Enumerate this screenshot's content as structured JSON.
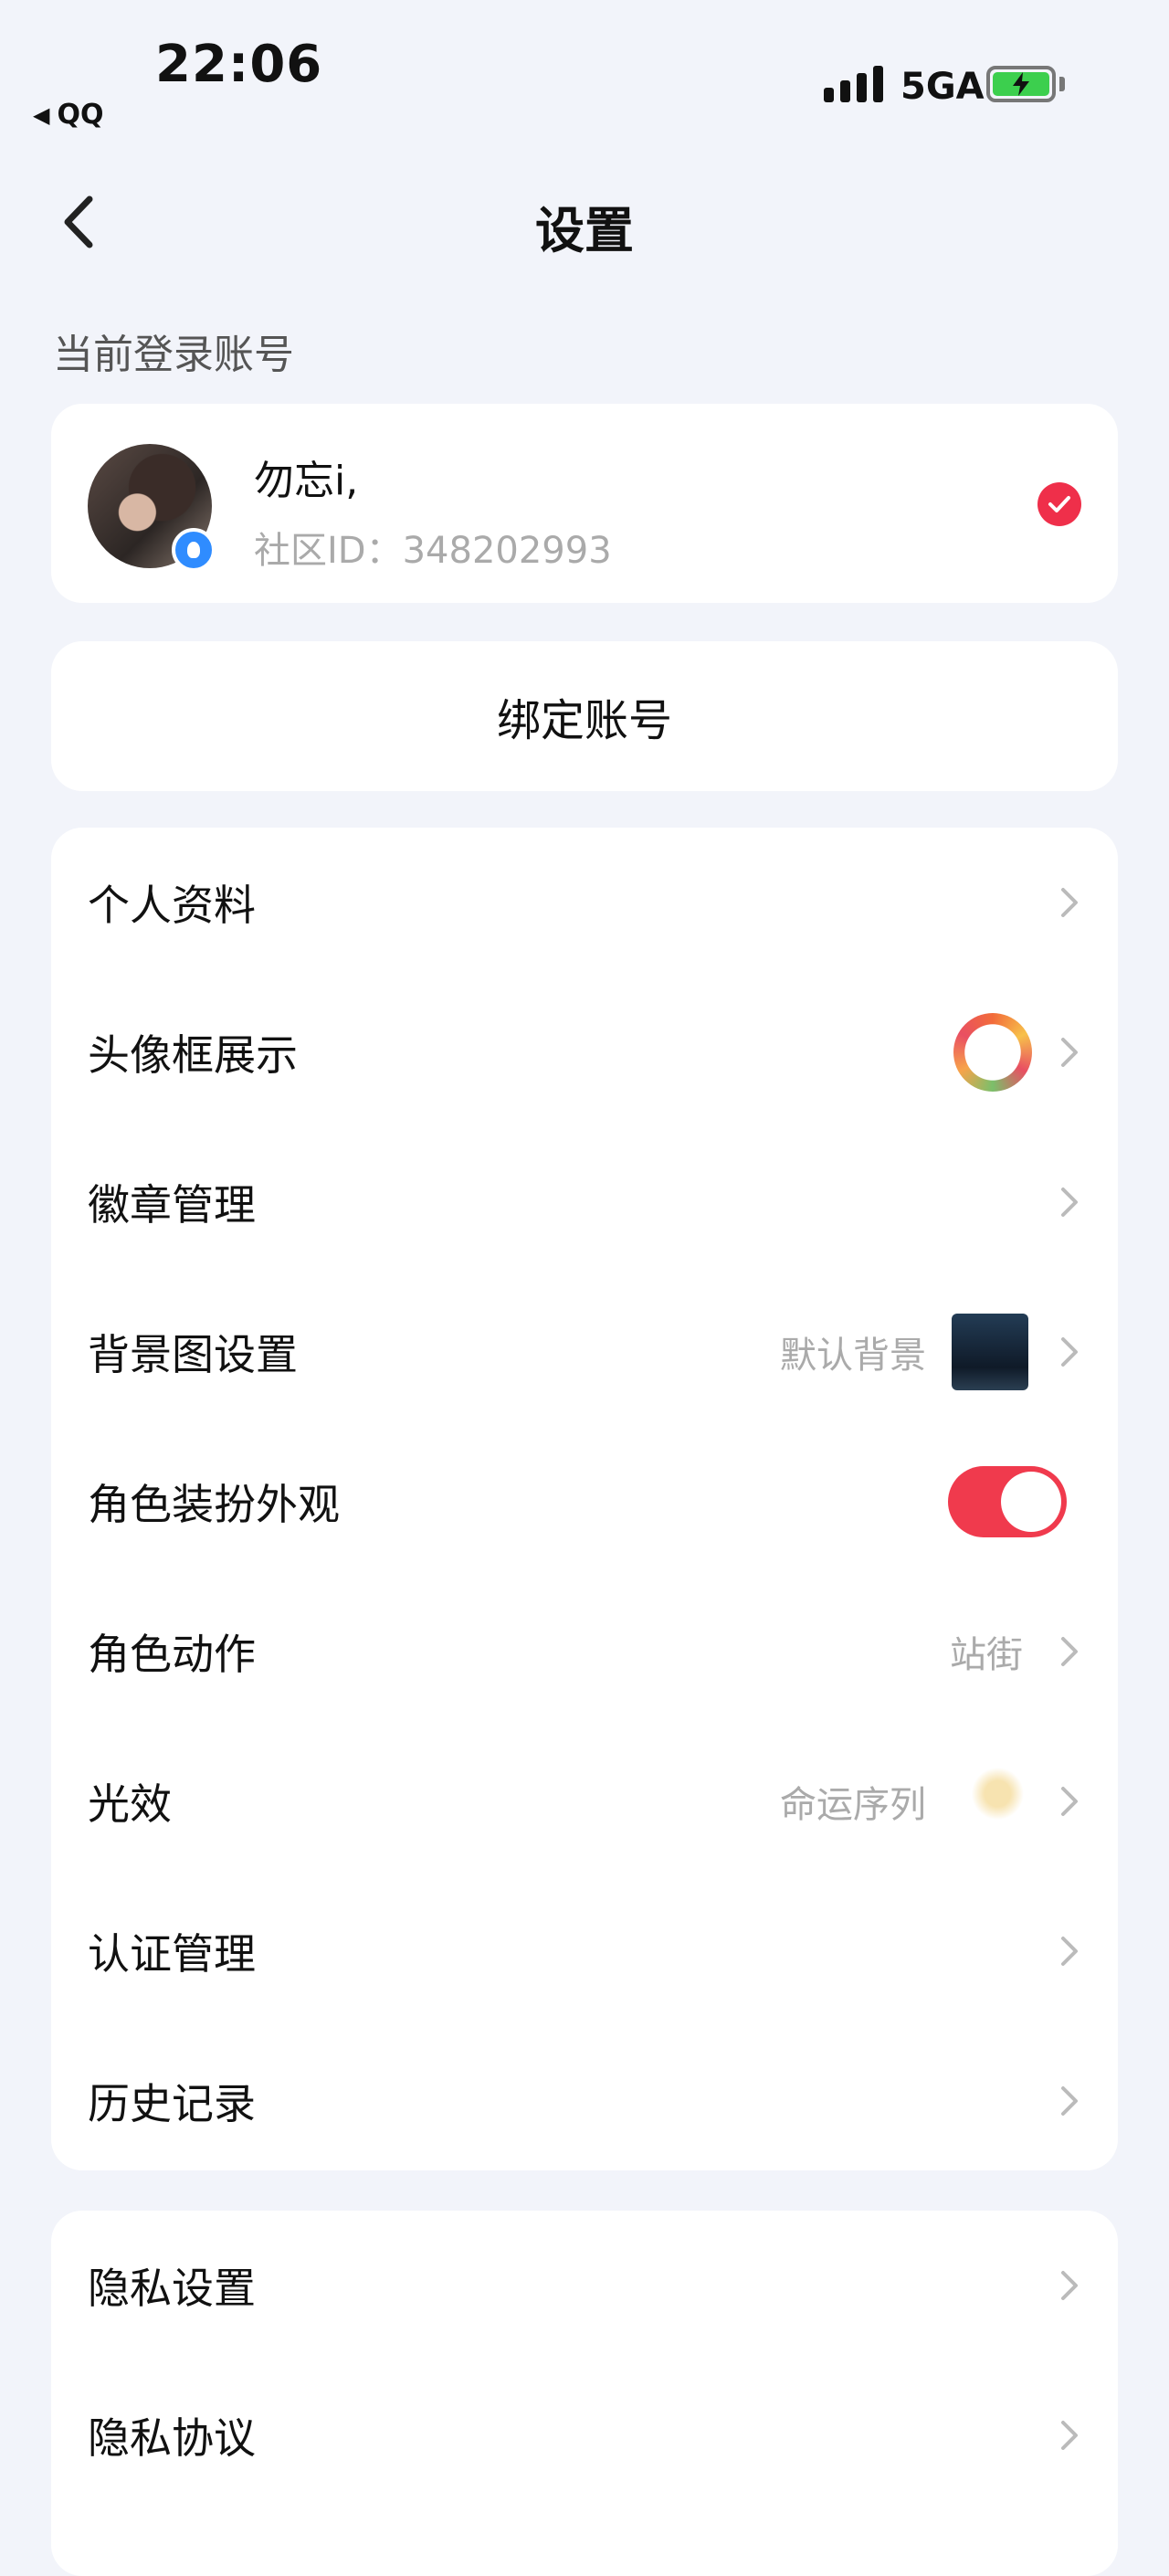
{
  "status_bar": {
    "time": "22:06",
    "back_app": "QQ",
    "network": "5GA"
  },
  "header": {
    "title": "设置"
  },
  "account_section": {
    "label": "当前登录账号",
    "name": "勿忘i,",
    "id_text": "社区ID：348202993"
  },
  "bind": {
    "label": "绑定账号"
  },
  "settings": [
    {
      "label": "个人资料"
    },
    {
      "label": "头像框展示"
    },
    {
      "label": "徽章管理"
    },
    {
      "label": "背景图设置",
      "value": "默认背景"
    },
    {
      "label": "角色装扮外观",
      "toggle": true
    },
    {
      "label": "角色动作",
      "value": "站街"
    },
    {
      "label": "光效",
      "value": "命运序列"
    },
    {
      "label": "认证管理"
    },
    {
      "label": "历史记录"
    }
  ],
  "privacy": [
    {
      "label": "隐私设置"
    },
    {
      "label": "隐私协议"
    }
  ],
  "colors": {
    "accent": "#f03a4d",
    "background": "#f2f4fa",
    "badge_blue": "#2f8cff"
  },
  "icons": [
    "back-arrow-icon",
    "chevron-right-icon",
    "check-icon",
    "qq-icon"
  ]
}
